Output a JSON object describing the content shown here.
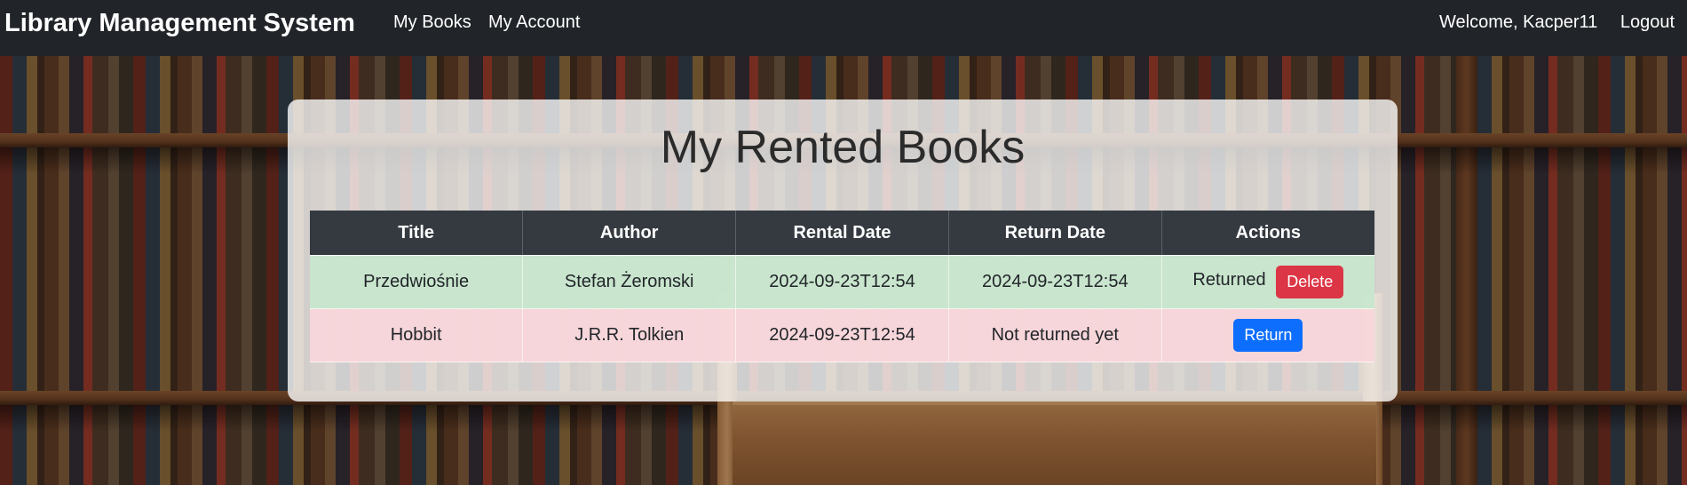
{
  "navbar": {
    "brand": "Library Management System",
    "links": [
      "My Books",
      "My Account"
    ],
    "welcome": "Welcome, Kacper11",
    "logout": "Logout"
  },
  "page": {
    "title": "My Rented Books"
  },
  "table": {
    "headers": [
      "Title",
      "Author",
      "Rental Date",
      "Return Date",
      "Actions"
    ],
    "rows": [
      {
        "title": "Przedwiośnie",
        "author": "Stefan Żeromski",
        "rental_date": "2024-09-23T12:54",
        "return_date": "2024-09-23T12:54",
        "status_text": "Returned",
        "action_label": "Delete",
        "row_color": "#d1e7dd"
      },
      {
        "title": "Hobbit",
        "author": "J.R.R. Tolkien",
        "rental_date": "2024-09-23T12:54",
        "return_date": "Not returned yet",
        "status_text": "",
        "action_label": "Return",
        "row_color": "#f8d7da"
      }
    ]
  },
  "colors": {
    "navbar_bg": "#212529",
    "table_header_bg": "#343a40",
    "danger": "#dc3545",
    "primary": "#0d6efd"
  }
}
